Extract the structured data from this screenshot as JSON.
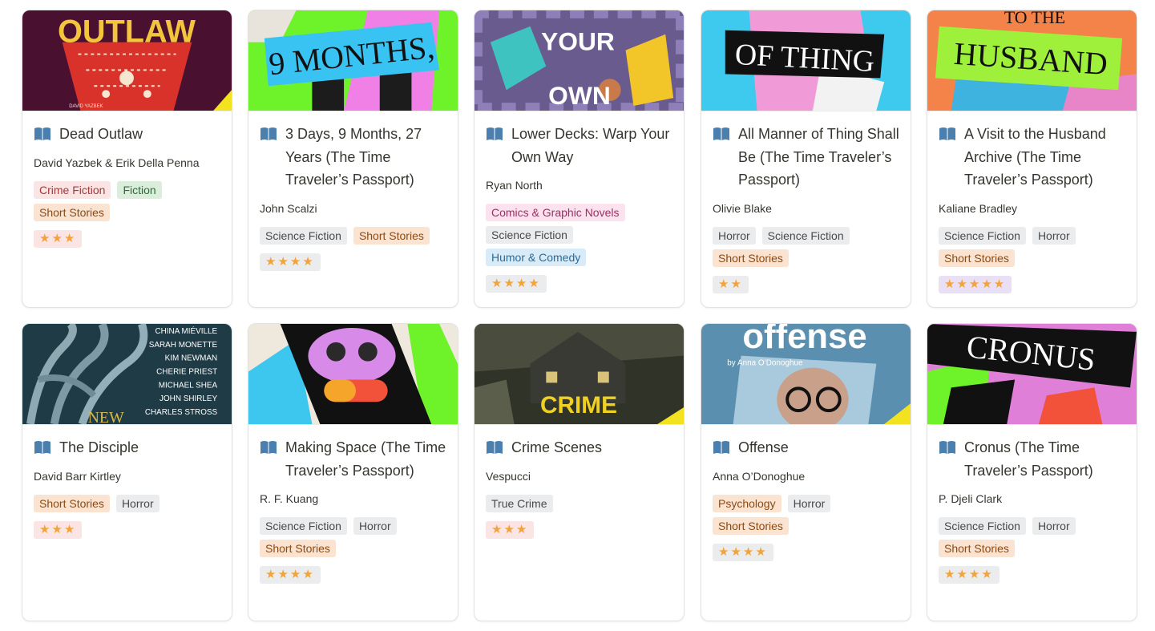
{
  "tag_colors": {
    "Crime Fiction": {
      "bg": "#fbe4e4",
      "fg": "#9f3a3a"
    },
    "Fiction": {
      "bg": "#dbeddb",
      "fg": "#2f6b3d"
    },
    "Short Stories": {
      "bg": "#fae3d0",
      "fg": "#8a4b17"
    },
    "Science Fiction": {
      "bg": "#ebeced",
      "fg": "#4a4a48"
    },
    "Horror": {
      "bg": "#ebeced",
      "fg": "#4a4a48"
    },
    "Comics & Graphic Novels": {
      "bg": "#fbe2ee",
      "fg": "#9c2f63"
    },
    "Humor & Comedy": {
      "bg": "#d9ebf6",
      "fg": "#2a6b9a"
    },
    "True Crime": {
      "bg": "#ebeced",
      "fg": "#4a4a48"
    },
    "Psychology": {
      "bg": "#fae3d0",
      "fg": "#8a4b17"
    }
  },
  "rating_colors": {
    "3": "#fbe4e4",
    "4": "#ebeced",
    "2": "#ebeced",
    "5": "#eae0f6"
  },
  "books": [
    {
      "title": "Dead Outlaw",
      "author": "David Yazbek & Erik Della Penna",
      "tags": [
        "Crime Fiction",
        "Fiction",
        "Short Stories"
      ],
      "rating": 3,
      "stars": "★★★",
      "cover_text": "OUTLAW",
      "cover_small": "DAVID YAZBEK"
    },
    {
      "title": "3 Days, 9 Months, 27 Years (The Time Traveler’s Passport)",
      "author": "John Scalzi",
      "tags": [
        "Science Fiction",
        "Short Stories"
      ],
      "rating": 4,
      "stars": "★★★★",
      "cover_text": "9 MONTHS,"
    },
    {
      "title": "Lower Decks: Warp Your Own Way",
      "author": "Ryan North",
      "tags": [
        "Comics & Graphic Novels",
        "Science Fiction",
        "Humor & Comedy"
      ],
      "rating": 4,
      "stars": "★★★★",
      "cover_text": "YOUR",
      "cover_text2": "OWN"
    },
    {
      "title": "All Manner of Thing Shall Be (The Time Traveler’s Passport)",
      "author": "Olivie Blake",
      "tags": [
        "Horror",
        "Science Fiction",
        "Short Stories"
      ],
      "rating": 2,
      "stars": "★★",
      "cover_text": "OF THING"
    },
    {
      "title": "A Visit to the Husband Archive (The Time Traveler’s Passport)",
      "author": "Kaliane Bradley",
      "tags": [
        "Science Fiction",
        "Horror",
        "Short Stories"
      ],
      "rating": 5,
      "stars": "★★★★★",
      "cover_text": "HUSBAND",
      "cover_small": "TO THE"
    },
    {
      "title": "The Disciple",
      "author": "David Barr Kirtley",
      "tags": [
        "Short Stories",
        "Horror"
      ],
      "rating": 3,
      "stars": "★★★",
      "cover_text": "NEW",
      "cover_names": [
        "CHINA MIÉVILLE",
        "SARAH MONETTE",
        "KIM NEWMAN",
        "CHERIE PRIEST",
        "MICHAEL SHEA",
        "JOHN SHIRLEY",
        "CHARLES STROSS"
      ]
    },
    {
      "title": "Making Space (The Time Traveler’s Passport)",
      "author": "R. F. Kuang",
      "tags": [
        "Science Fiction",
        "Horror",
        "Short Stories"
      ],
      "rating": 4,
      "stars": "★★★★"
    },
    {
      "title": "Crime Scenes",
      "author": "Vespucci",
      "tags": [
        "True Crime"
      ],
      "rating": 3,
      "stars": "★★★",
      "cover_text": "CRIME"
    },
    {
      "title": "Offense",
      "author": "Anna O’Donoghue",
      "tags": [
        "Psychology",
        "Horror",
        "Short Stories"
      ],
      "rating": 4,
      "stars": "★★★★",
      "cover_text": "offense",
      "cover_small": "by Anna O’Donoghue"
    },
    {
      "title": "Cronus (The Time Traveler’s Passport)",
      "author": "P. Djeli Clark",
      "tags": [
        "Science Fiction",
        "Horror",
        "Short Stories"
      ],
      "rating": 4,
      "stars": "★★★★",
      "cover_text": "CRONUS"
    }
  ]
}
